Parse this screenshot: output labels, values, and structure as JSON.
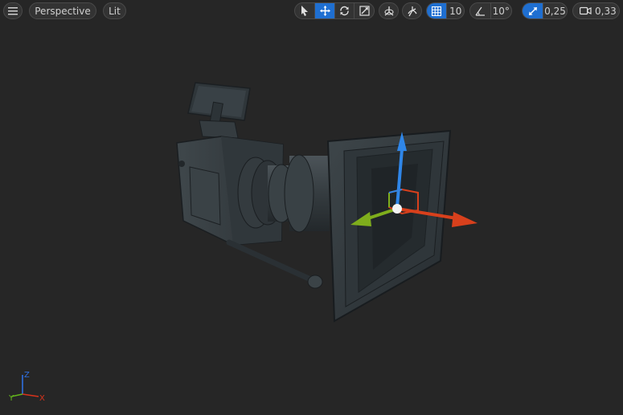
{
  "toolbar": {
    "view_mode": "Perspective",
    "lighting_mode": "Lit",
    "grid_snap_value": "10",
    "rotation_snap_value": "10°",
    "scale_snap_value": "0,25",
    "camera_speed_value": "0,33"
  },
  "axis_indicator": {
    "x_label": "X",
    "y_label": "Y",
    "z_label": "Z"
  },
  "colors": {
    "background": "#262626",
    "accent": "#1f6fd1",
    "gizmo_x": "#d8401c",
    "gizmo_y": "#7fae1c",
    "gizmo_z": "#2f86e8"
  },
  "icons": {
    "menu": "hamburger-icon",
    "select": "cursor-icon",
    "translate": "move-arrows-icon",
    "rotate": "rotate-icon",
    "scale": "scale-icon",
    "world_local": "world-icon",
    "surface_snap": "surface-snap-icon",
    "grid_snap": "grid-icon",
    "rotation_snap": "angle-icon",
    "scale_snap": "scale-snap-icon",
    "camera_speed": "camera-icon"
  }
}
